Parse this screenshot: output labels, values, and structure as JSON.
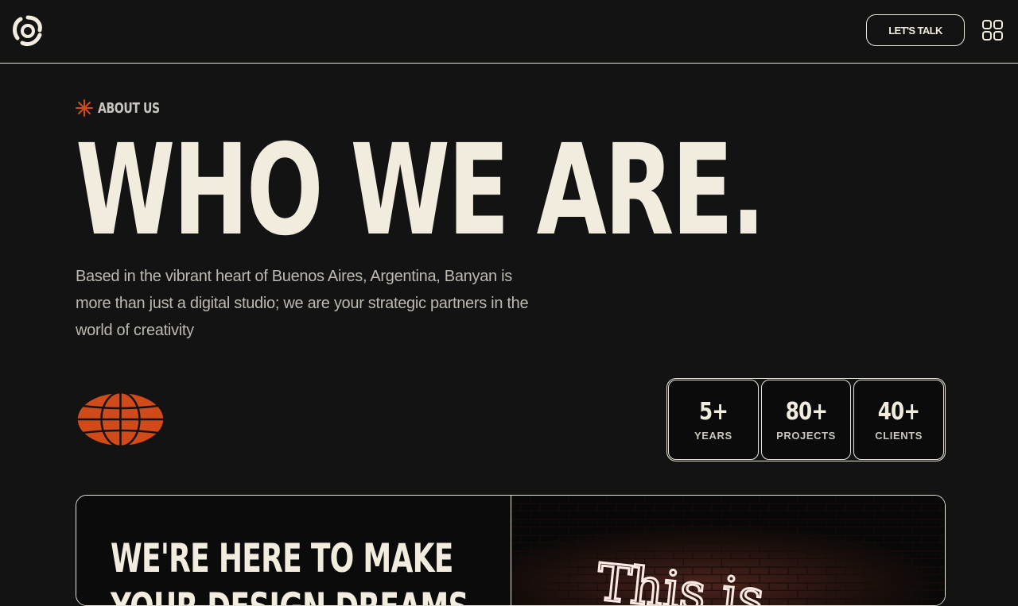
{
  "header": {
    "logo_icon": "swirl-logo-icon",
    "cta_label": "LET'S TALK",
    "menu_icon": "grid-menu-icon"
  },
  "about": {
    "eyebrow_icon": "asterisk-icon",
    "eyebrow": "ABOUT US",
    "headline": "WHO WE ARE.",
    "intro": "Based in the vibrant heart of Buenos Aires, Argentina, Banyan is more than just a digital studio; we are your strategic partners in the world of creativity",
    "globe_icon": "globe-icon"
  },
  "stats": [
    {
      "value": "5+",
      "label": "YEARS"
    },
    {
      "value": "80+",
      "label": "PROJECTS"
    },
    {
      "value": "40+",
      "label": "CLIENTS"
    }
  ],
  "card": {
    "title_line1": "WE'RE HERE TO MAKE",
    "title_line2": "YOUR DESIGN DREAMS",
    "neon_text": "This is"
  },
  "colors": {
    "background": "#131313",
    "cream": "#f2ecdf",
    "accent_orange": "#d14b1a",
    "muted_text": "#bdb9b2"
  }
}
